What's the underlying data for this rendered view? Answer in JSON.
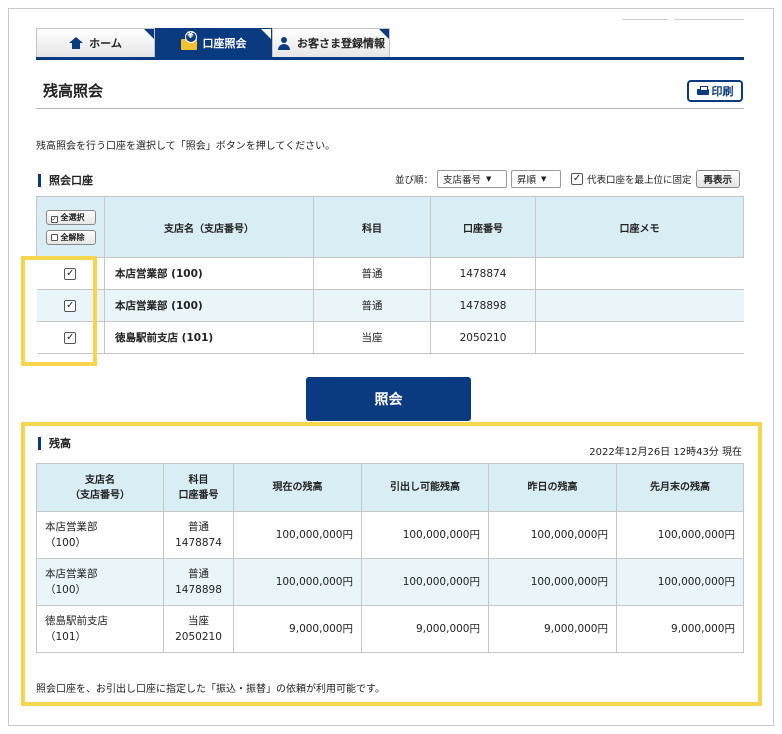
{
  "nav": {
    "tabs": [
      {
        "label": "ホーム",
        "icon": "home-icon",
        "active": false
      },
      {
        "label": "口座照会",
        "icon": "wallet-icon",
        "active": true
      },
      {
        "label": "お客さま登録情報",
        "icon": "person-icon",
        "active": false
      }
    ]
  },
  "page": {
    "title": "残高照会",
    "print_label": "印刷",
    "instruction": "残高照会を行う口座を選択して「照会」ボタンを押してください。"
  },
  "inquiry": {
    "section_title": "照会口座",
    "sort_label": "並び順：",
    "sort_key": "支店番号",
    "sort_order": "昇順",
    "pin_checkbox_checked": true,
    "pin_label": "代表口座を最上位に固定",
    "redisplay_label": "再表示",
    "select_all_label": "全選択",
    "deselect_all_label": "全解除",
    "headers": [
      "支店名（支店番号）",
      "科目",
      "口座番号",
      "口座メモ"
    ],
    "rows": [
      {
        "checked": true,
        "branch": "本店営業部 (100)",
        "type": "普通",
        "number": "1478874",
        "memo": ""
      },
      {
        "checked": true,
        "branch": "本店営業部 (100)",
        "type": "普通",
        "number": "1478898",
        "memo": ""
      },
      {
        "checked": true,
        "branch": "徳島駅前支店 (101)",
        "type": "当座",
        "number": "2050210",
        "memo": ""
      }
    ],
    "submit_label": "照会"
  },
  "balance": {
    "section_title": "残高",
    "timestamp": "2022年12月26日 12時43分 現在",
    "headers": {
      "branch_1": "支店名",
      "branch_2": "（支店番号）",
      "acct_1": "科目",
      "acct_2": "口座番号",
      "current": "現在の残高",
      "withdrawable": "引出し可能残高",
      "yesterday": "昨日の残高",
      "last_month": "先月末の残高"
    },
    "rows": [
      {
        "branch": "本店営業部",
        "branch_no": "（100）",
        "type": "普通",
        "number": "1478874",
        "current": "100,000,000円",
        "withdrawable": "100,000,000円",
        "yesterday": "100,000,000円",
        "last_month": "100,000,000円"
      },
      {
        "branch": "本店営業部",
        "branch_no": "（100）",
        "type": "普通",
        "number": "1478898",
        "current": "100,000,000円",
        "withdrawable": "100,000,000円",
        "yesterday": "100,000,000円",
        "last_month": "100,000,000円"
      },
      {
        "branch": "徳島駅前支店",
        "branch_no": "（101）",
        "type": "当座",
        "number": "2050210",
        "current": "9,000,000円",
        "withdrawable": "9,000,000円",
        "yesterday": "9,000,000円",
        "last_month": "9,000,000円"
      }
    ],
    "footnote": "照会口座を、お引出し口座に指定した「振込・振替」の依頼が利用可能です。"
  },
  "colors": {
    "brand": "#0a3a80",
    "header_bg": "#d8edf4",
    "row_alt": "#eaf5fa",
    "highlight": "#f7d64e"
  }
}
